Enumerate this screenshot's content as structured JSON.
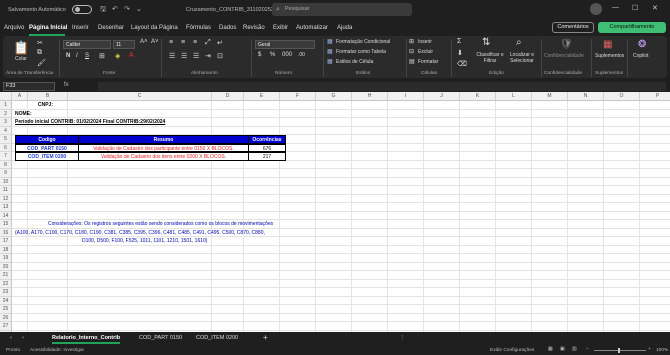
{
  "titlebar": {
    "autosave_label": "Salvamento Automático",
    "document_title": "Cruzamento_CONTRIB_31102025223633",
    "search_placeholder": "Pesquisar"
  },
  "menu": {
    "items": [
      "Arquivo",
      "Página Inicial",
      "Inserir",
      "Desenhar",
      "Layout da Página",
      "Fórmulas",
      "Dados",
      "Revisão",
      "Exibir",
      "Automatizar",
      "Ajuda"
    ],
    "active": "Página Inicial",
    "comments_label": "Comentários",
    "share_label": "Compartilhamento"
  },
  "ribbon": {
    "clipboard": {
      "paste_label": "Colar",
      "group_label": "Área de Transferência"
    },
    "font": {
      "name": "Calibri",
      "size": "11",
      "group_label": "Fonte"
    },
    "alignment": {
      "group_label": "Alinhamento"
    },
    "number": {
      "format": "Geral",
      "group_label": "Número"
    },
    "styles": {
      "conditional": "Formatação Condicional",
      "table": "Formatar como Tabela",
      "cell_styles": "Estilos de Célula",
      "group_label": "Estilos"
    },
    "cells": {
      "insert": "Inserir",
      "delete": "Excluir",
      "format": "Formatar",
      "group_label": "Células"
    },
    "editing": {
      "sort": "Classificar e Filtrar",
      "find": "Localizar e Selecionar",
      "group_label": "Edição"
    },
    "sensitivity": {
      "label": "Confidencialidade",
      "group_label": "Confidencialidade"
    },
    "addins": {
      "label": "Suplementos",
      "group_label": "Suplementos"
    },
    "copilot": {
      "label": "Copilot"
    }
  },
  "formula_bar": {
    "name_box": "F33",
    "fx": "fx",
    "value": ""
  },
  "grid": {
    "columns": [
      "A",
      "B",
      "C",
      "D",
      "E",
      "F",
      "G",
      "H",
      "I",
      "J",
      "K",
      "L",
      "M",
      "N",
      "O",
      "P",
      "Q"
    ],
    "rows": [
      "1",
      "2",
      "3",
      "4",
      "5",
      "6",
      "7",
      "8",
      "9",
      "10",
      "11",
      "12",
      "13",
      "14",
      "15",
      "16",
      "17",
      "18",
      "19",
      "20",
      "21",
      "22",
      "23",
      "24",
      "25",
      "26",
      "27",
      "28",
      "29"
    ]
  },
  "report": {
    "cnpj_label": "CNPJ:",
    "nome_label": "NOME:",
    "period_text": "Período inicial CONTRIB: 01/02/2024    Final CONTRIB:29/02/2024",
    "table_headers": [
      "Codigo",
      "Resumo",
      "Ocorrências"
    ],
    "table_rows": [
      {
        "codigo": "COD_PART 0150",
        "resumo": "Validação de Cadastro dos participante entre 0150 X BLOCOS.",
        "ocorrencias": "676"
      },
      {
        "codigo": "COD_ITEM 0200",
        "resumo": "Validação de Cadastro dos itens entre 0200 X BLOCOS.",
        "ocorrencias": "217"
      }
    ],
    "note_line1": "Considerações: Os registros seguintes estão sendo considerados como os blocos de movimentações",
    "note_line2": "(A100, A170, C100, C170, C180, C190, C381, C385, C395, C396, C481, C485, C491, C495, C500, C870, C880,",
    "note_line3": "D100, D500, F100, F525, 1011, 1101, 1210, 1501, 1610)"
  },
  "sheets": {
    "tabs": [
      "Relatorio_Interno_Contrib",
      "COD_PART 0150",
      "COD_ITEM 0200"
    ],
    "active": "Relatorio_Interno_Contrib",
    "add_label": "+"
  },
  "status": {
    "ready": "Pronto",
    "accessibility": "Acessibilidade: Investigar",
    "display_settings": "Exibir Configurações",
    "zoom": "100%"
  },
  "colors": {
    "accent": "#22a35a",
    "table_header_bg": "#0000cc",
    "note_blue": "#1f3fd0",
    "resumo_red": "#e02020"
  }
}
